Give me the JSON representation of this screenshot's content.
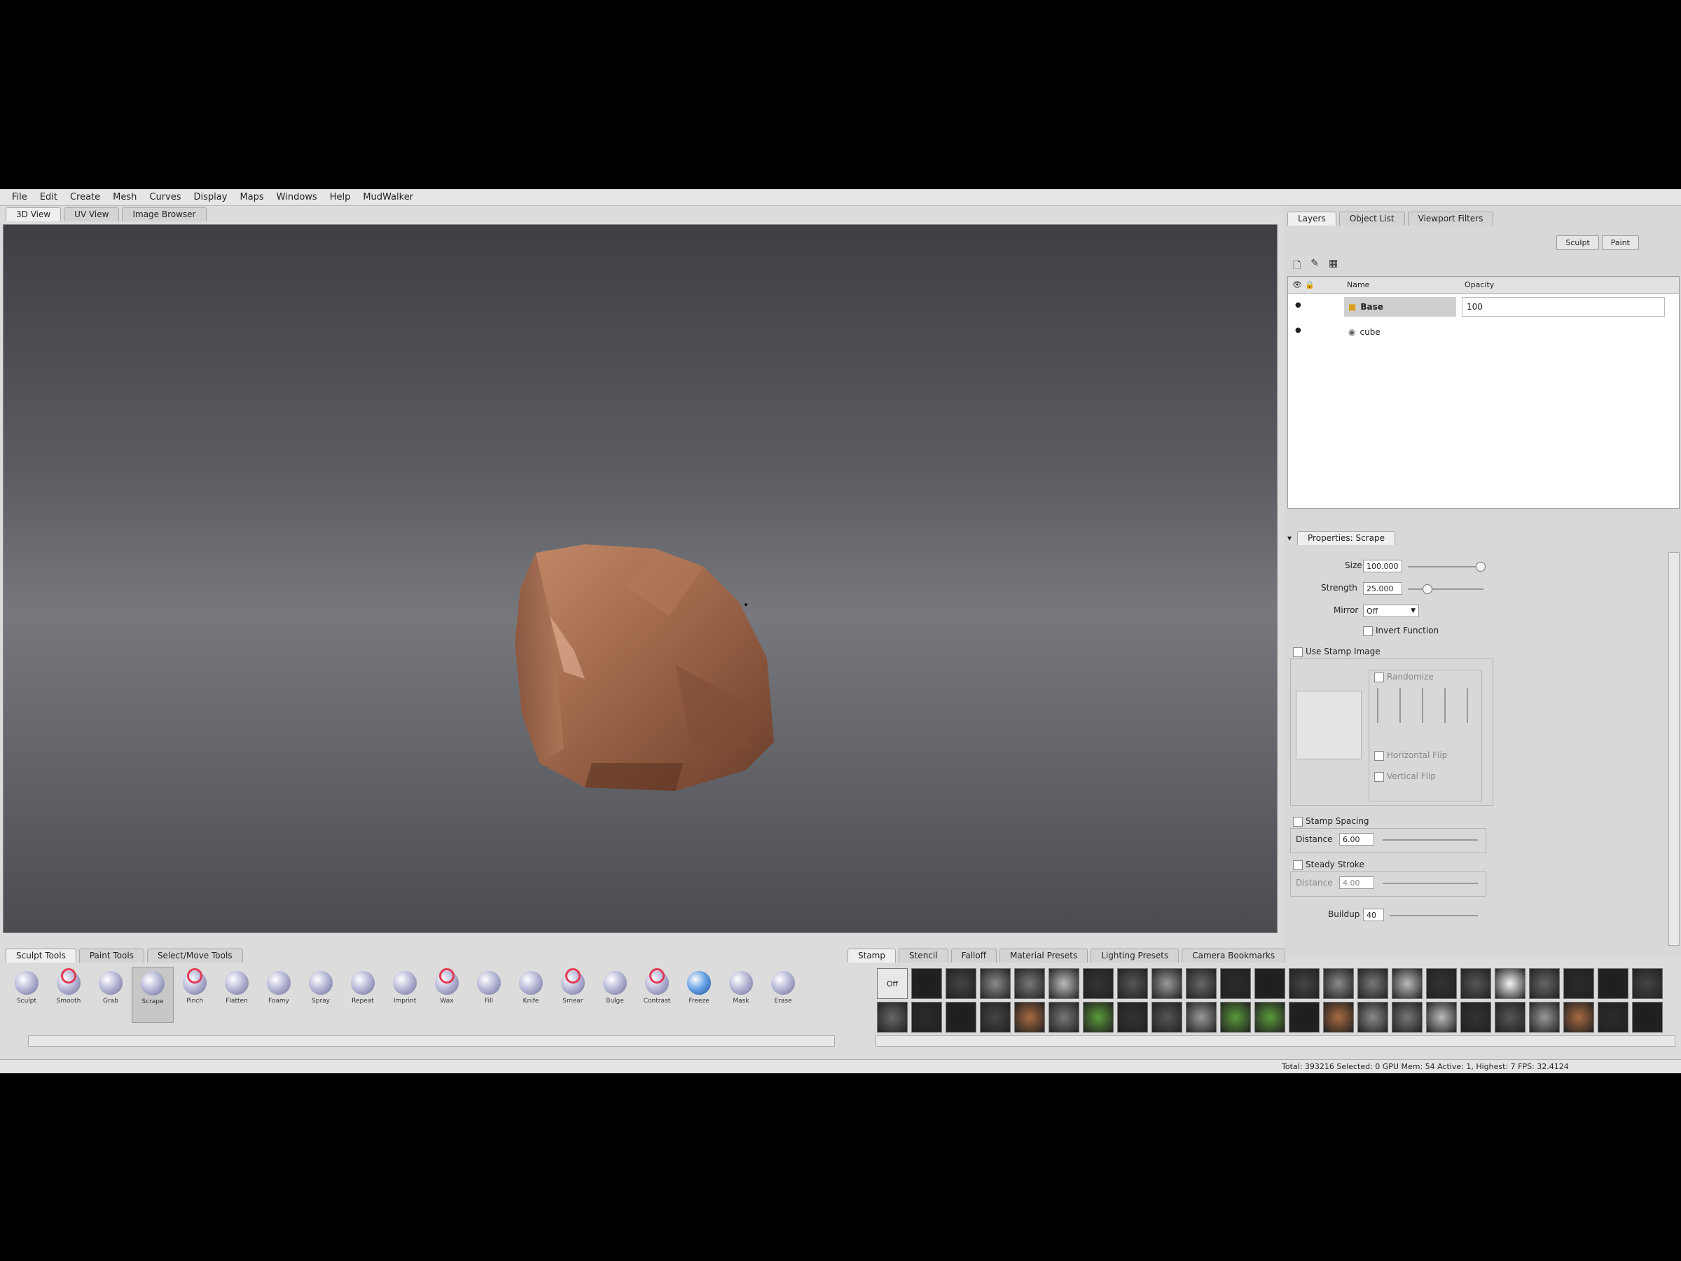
{
  "menu": [
    "File",
    "Edit",
    "Create",
    "Mesh",
    "Curves",
    "Display",
    "Maps",
    "Windows",
    "Help",
    "MudWalker"
  ],
  "view_tabs": [
    "3D View",
    "UV View",
    "Image Browser"
  ],
  "right_tabs": [
    "Layers",
    "Object List",
    "Viewport Filters"
  ],
  "layer_buttons": {
    "sculpt": "Sculpt",
    "paint": "Paint"
  },
  "layers_table": {
    "headers": {
      "name": "Name",
      "opacity": "Opacity"
    },
    "rows": [
      {
        "name": "Base",
        "opacity": "100"
      },
      {
        "name": "cube",
        "opacity": ""
      }
    ]
  },
  "properties": {
    "title": "Properties: Scrape",
    "size_label": "Size",
    "size_value": "100.000",
    "size_level": 0.95,
    "strength_label": "Strength",
    "strength_value": "25.000",
    "strength_level": 0.25,
    "mirror_label": "Mirror",
    "mirror_value": "Off",
    "invert_label": "Invert Function",
    "use_stamp_label": "Use Stamp Image",
    "randomize_label": "Randomize",
    "hflip_label": "Horizontal Flip",
    "vflip_label": "Vertical Flip",
    "stamp_spacing_label": "Stamp Spacing",
    "distance_label": "Distance",
    "distance_value": "6.00",
    "steady_label": "Steady Stroke",
    "steady_distance_value": "4.00",
    "buildup_label": "Buildup",
    "buildup_value": "40"
  },
  "tool_tabs": [
    "Sculpt Tools",
    "Paint Tools",
    "Select/Move Tools"
  ],
  "tools": [
    {
      "label": "Sculpt",
      "style": "plain"
    },
    {
      "label": "Smooth",
      "style": "red"
    },
    {
      "label": "Grab",
      "style": "plain"
    },
    {
      "label": "Scrape",
      "style": "plain",
      "active": true
    },
    {
      "label": "Pinch",
      "style": "red"
    },
    {
      "label": "Flatten",
      "style": "plain"
    },
    {
      "label": "Foamy",
      "style": "plain"
    },
    {
      "label": "Spray",
      "style": "plain"
    },
    {
      "label": "Repeat",
      "style": "plain"
    },
    {
      "label": "Imprint",
      "style": "plain"
    },
    {
      "label": "Wax",
      "style": "red"
    },
    {
      "label": "Fill",
      "style": "plain"
    },
    {
      "label": "Knife",
      "style": "plain"
    },
    {
      "label": "Smear",
      "style": "red"
    },
    {
      "label": "Bulge",
      "style": "plain"
    },
    {
      "label": "Contrast",
      "style": "red"
    },
    {
      "label": "Freeze",
      "style": "blue"
    },
    {
      "label": "Mask",
      "style": "plain"
    },
    {
      "label": "Erase",
      "style": "plain"
    }
  ],
  "stamp_tabs": [
    "Stamp",
    "Stencil",
    "Falloff",
    "Material Presets",
    "Lighting Presets",
    "Camera Bookmarks"
  ],
  "stamp_off_label": "Off",
  "status_text": "Total: 393216  Selected: 0 GPU Mem: 54  Active: 1, Highest: 7  FPS: 32.4124",
  "colors": {
    "rock": "#a06a4e",
    "accent": "#e23a54"
  }
}
